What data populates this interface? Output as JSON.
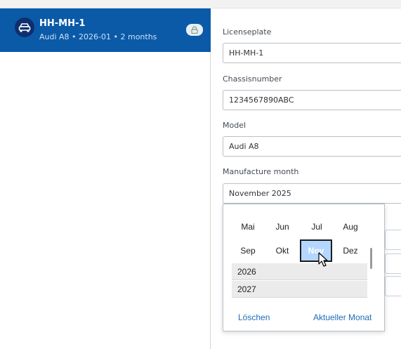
{
  "vehicle": {
    "title": "HH-MH-1",
    "subtitle": "Audi A8 • 2026-01 • 2 months",
    "icon": "car-icon",
    "status_icon": "lock-icon"
  },
  "form": {
    "licenseplate_label": "Licenseplate",
    "licenseplate_value": "HH-MH-1",
    "chassis_label": "Chassisnumber",
    "chassis_value": "1234567890ABC",
    "model_label": "Model",
    "model_value": "Audi A8",
    "month_label": "Manufacture month",
    "month_value": "November 2025"
  },
  "picker": {
    "months_row1": [
      "Mai",
      "Jun",
      "Jul",
      "Aug"
    ],
    "months_row2": [
      "Sep",
      "Okt",
      "Nov",
      "Dez"
    ],
    "selected_month": "Nov",
    "years": [
      "2026",
      "2027"
    ],
    "clear_label": "Löschen",
    "current_month_label": "Aktueller Monat"
  },
  "colors": {
    "accent": "#0a5aa8",
    "selected_bg": "#b3d7ff",
    "link": "#1a6db8"
  }
}
